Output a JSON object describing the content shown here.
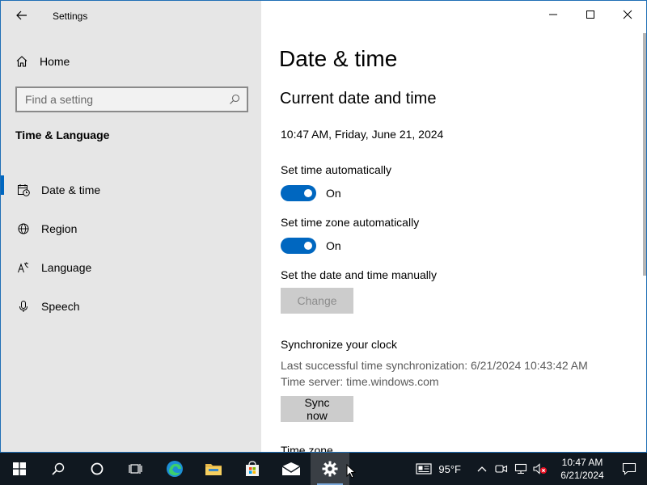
{
  "window": {
    "app_title": "Settings"
  },
  "sidebar": {
    "home_label": "Home",
    "search_placeholder": "Find a setting",
    "section_title": "Time & Language",
    "items": [
      {
        "label": "Date & time",
        "icon": "calendar-clock-icon",
        "active": true
      },
      {
        "label": "Region",
        "icon": "globe-icon",
        "active": false
      },
      {
        "label": "Language",
        "icon": "language-icon",
        "active": false
      },
      {
        "label": "Speech",
        "icon": "microphone-icon",
        "active": false
      }
    ]
  },
  "content": {
    "page_title": "Date & time",
    "sub_title": "Current date and time",
    "current_datetime": "10:47 AM, Friday, June 21, 2024",
    "set_time_auto_label": "Set time automatically",
    "set_time_auto_state": "On",
    "set_timezone_auto_label": "Set time zone automatically",
    "set_timezone_auto_state": "On",
    "manual_label": "Set the date and time manually",
    "change_button": "Change",
    "sync_heading": "Synchronize your clock",
    "last_sync": "Last successful time synchronization: 6/21/2024 10:43:42 AM",
    "time_server": "Time server: time.windows.com",
    "sync_button": "Sync now",
    "timezone_heading_partial": "Time zone"
  },
  "taskbar": {
    "weather_temp": "95°F",
    "clock_time": "10:47 AM",
    "clock_date": "6/21/2024"
  },
  "colors": {
    "accent": "#0067c0",
    "sidebar_bg": "#e6e6e6",
    "taskbar_bg": "#101820"
  }
}
